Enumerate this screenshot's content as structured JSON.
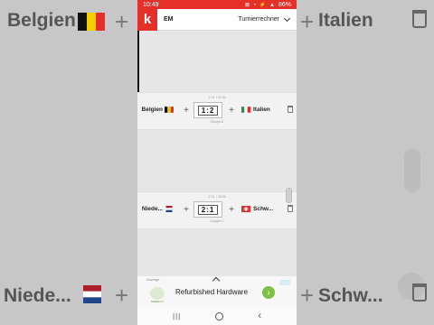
{
  "status_bar": {
    "time": "10:49",
    "icons": "⊠ ◔ ⚡ ▲",
    "battery": "86%"
  },
  "app": {
    "logo": "k",
    "title": "EM",
    "dropdown_label": "Turnierrechner"
  },
  "matches": [
    {
      "meta_top": "17.6. / 21:00",
      "home": "Belgien",
      "home_flag": "belgium",
      "score": "1:2",
      "meta_bottom": "Gruppe E",
      "away": "Italien",
      "away_flag": "italy"
    },
    {
      "meta_top": "17.6. / 18:00",
      "home": "Niede...",
      "home_flag": "netherlands",
      "score": "2:1",
      "meta_bottom": "Gruppe C",
      "away": "Schw...",
      "away_flag": "switzerland"
    }
  ],
  "ad": {
    "label": "Anzeige",
    "title": "Refurbished Hardware",
    "advertiser": "GREEN IT"
  },
  "background": {
    "top_home": "Belgien",
    "top_away": "Italien",
    "bottom_home": "Niede...",
    "bottom_away": "Schw..."
  },
  "colors": {
    "brand": "#e5302a",
    "ad_button": "#7cc142"
  }
}
